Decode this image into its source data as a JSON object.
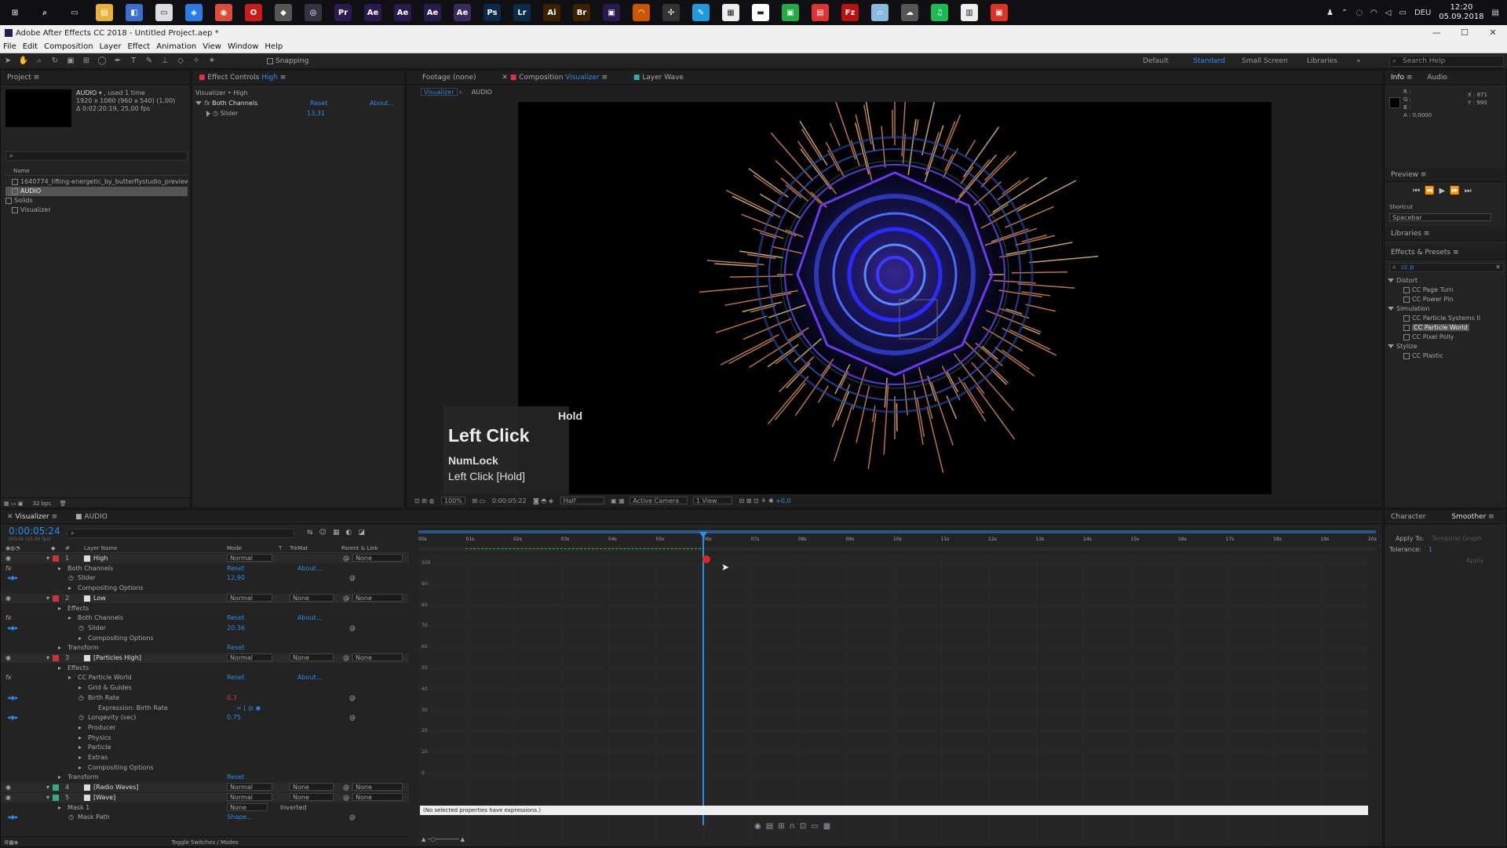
{
  "taskbar": {
    "apps": [
      {
        "name": "windows-start",
        "label": "⊞",
        "color": "#0f0f14"
      },
      {
        "name": "search",
        "label": "⌕",
        "color": "#0f0f14"
      },
      {
        "name": "task-view",
        "label": "▭",
        "color": "#0f0f14"
      },
      {
        "name": "file-explorer",
        "label": "▤",
        "color": "#e8b13a"
      },
      {
        "name": "app-blue",
        "label": "◧",
        "color": "#3a6fd0"
      },
      {
        "name": "app-white",
        "label": "▭",
        "color": "#dddddd"
      },
      {
        "name": "store",
        "label": "◈",
        "color": "#2a7be4"
      },
      {
        "name": "chrome",
        "label": "◉",
        "color": "#dd4b39"
      },
      {
        "name": "opera",
        "label": "O",
        "color": "#cc1b1b"
      },
      {
        "name": "app-gray",
        "label": "◆",
        "color": "#555555"
      },
      {
        "name": "app-obs",
        "label": "◎",
        "color": "#333344"
      },
      {
        "name": "premiere",
        "label": "Pr",
        "color": "#2a1a4d"
      },
      {
        "name": "after-effects-a",
        "label": "Ae",
        "color": "#2a1a4d"
      },
      {
        "name": "after-effects-b",
        "label": "Ae",
        "color": "#2a1a4d"
      },
      {
        "name": "after-effects-c",
        "label": "Ae",
        "color": "#2a1a4d"
      },
      {
        "name": "after-effects-d",
        "label": "Ae",
        "color": "#3a2a5d"
      },
      {
        "name": "photoshop",
        "label": "Ps",
        "color": "#0a2a4a"
      },
      {
        "name": "lightroom",
        "label": "Lr",
        "color": "#0a2a4a"
      },
      {
        "name": "illustrator",
        "label": "Ai",
        "color": "#3a2200"
      },
      {
        "name": "bridge",
        "label": "Br",
        "color": "#3a2200"
      },
      {
        "name": "media-encoder",
        "label": "▣",
        "color": "#2a1a4d"
      },
      {
        "name": "audition",
        "label": "◠",
        "color": "#cc5500"
      },
      {
        "name": "app-tools",
        "label": "✣",
        "color": "#333333"
      },
      {
        "name": "app-brush",
        "label": "✎",
        "color": "#2299dd"
      },
      {
        "name": "app-note",
        "label": "▦",
        "color": "#eeeeee"
      },
      {
        "name": "app-capture",
        "label": "▬",
        "color": "#ffffff"
      },
      {
        "name": "app-green",
        "label": "▣",
        "color": "#22aa44"
      },
      {
        "name": "app-redbox",
        "label": "▤",
        "color": "#dd3333"
      },
      {
        "name": "filezilla",
        "label": "Fz",
        "color": "#bb1111"
      },
      {
        "name": "app-notepad",
        "label": "▱",
        "color": "#88bbdd"
      },
      {
        "name": "app-cloud",
        "label": "☁",
        "color": "#555555"
      },
      {
        "name": "spotify",
        "label": "♫",
        "color": "#1db954"
      },
      {
        "name": "app-clapper",
        "label": "▥",
        "color": "#eeeeee"
      },
      {
        "name": "app-red-square",
        "label": "▣",
        "color": "#dd3322"
      }
    ],
    "tray_lang": "DEU",
    "time": "12:20",
    "date": "05.09.2018"
  },
  "window": {
    "title": "Adobe After Effects CC 2018 - Untitled Project.aep *"
  },
  "menu": [
    "File",
    "Edit",
    "Composition",
    "Layer",
    "Effect",
    "Animation",
    "View",
    "Window",
    "Help"
  ],
  "toolbar": {
    "snapping": "Snapping",
    "workspaces": [
      "Default",
      "Standard",
      "Small Screen",
      "Libraries"
    ],
    "search_placeholder": "Search Help"
  },
  "project": {
    "tab": "Project",
    "item_name": "AUDIO",
    "item_used": ", used 1 time",
    "item_info1": "1920 x 1080 (960 x 540) (1,00)",
    "item_info2": "Δ 0:02:20:19, 25,00 fps",
    "col_name": "Name",
    "items": [
      {
        "label": "1640774_lifting-energetic_by_butterflystudio_preview",
        "sel": false
      },
      {
        "label": "AUDIO",
        "sel": true
      },
      {
        "label": "Solids",
        "sel": false
      },
      {
        "label": "Visualizer",
        "sel": false
      }
    ],
    "bpc": "32 bpc"
  },
  "effect_controls": {
    "tab": "Effect Controls",
    "tab_layer": "High",
    "path": "Visualizer • High",
    "effect": "Both Channels",
    "reset": "Reset",
    "about": "About...",
    "slider_label": "Slider",
    "slider_value": "13,31"
  },
  "viewer": {
    "tabs": [
      "Footage (none)",
      "Composition",
      "Layer Wave"
    ],
    "comp_name": "Visualizer",
    "subtabs": [
      "Visualizer",
      "AUDIO"
    ],
    "overlay": {
      "hold": "Hold",
      "main": "Left Click",
      "sub1": "NumLock",
      "sub2": "Left Click [Hold]"
    },
    "zoom": "100%",
    "timecode": "0:00:05:22",
    "resolution": "Half",
    "camera": "Active Camera",
    "views": "1 View",
    "exposure": "+0,0"
  },
  "info": {
    "tab": "Info",
    "tab2": "Audio",
    "r": "R :",
    "g": "G :",
    "b": "B :",
    "a": "A : 0,0000",
    "x": "X : 871",
    "y": "Y : 990"
  },
  "preview": {
    "tab": "Preview",
    "shortcut_label": "Shortcut",
    "shortcut_value": "Spacebar"
  },
  "libraries": {
    "tab": "Libraries"
  },
  "effects_presets": {
    "tab": "Effects & Presets",
    "search": "cc p",
    "groups": [
      {
        "name": "Distort",
        "items": [
          "CC Page Turn",
          "CC Power Pin"
        ]
      },
      {
        "name": "Simulation",
        "items": [
          "CC Particle Systems II",
          "CC Particle World",
          "CC Pixel Polly"
        ]
      },
      {
        "name": "Stylize",
        "items": [
          "CC Plastic"
        ]
      }
    ],
    "selected": "CC Particle World"
  },
  "character": {
    "tab": "Character",
    "tab2": "Smoother",
    "apply_to": "Apply To:",
    "apply_value": "Temporal Graph",
    "tolerance": "Tolerance:",
    "tolerance_value": "1",
    "apply_btn": "Apply"
  },
  "timeline": {
    "tabs": [
      "Visualizer",
      "AUDIO"
    ],
    "timecode": "0:00:05:24",
    "timecode_sub": "00149 (25.00 fps)",
    "cols": {
      "layer_name": "Layer Name",
      "mode": "Mode",
      "t": "T",
      "trkmat": "TrkMat",
      "parent": "Parent & Link"
    },
    "rows": [
      {
        "type": "layer",
        "num": "1",
        "name": "High",
        "color": "#c33",
        "mode": "Normal",
        "trk": "",
        "parent": "None",
        "indent": 0
      },
      {
        "type": "effect",
        "name": "Both Channels",
        "reset": "Reset",
        "about": "About...",
        "indent": 1
      },
      {
        "type": "prop",
        "name": "Slider",
        "value": "12,90",
        "indent": 2
      },
      {
        "type": "group",
        "name": "Compositing Options",
        "indent": 2
      },
      {
        "type": "layer",
        "num": "2",
        "name": "Low",
        "color": "#c33",
        "mode": "Normal",
        "trk": "None",
        "parent": "None",
        "indent": 0
      },
      {
        "type": "group",
        "name": "Effects",
        "indent": 1
      },
      {
        "type": "effect",
        "name": "Both Channels",
        "reset": "Reset",
        "about": "About...",
        "indent": 2
      },
      {
        "type": "prop",
        "name": "Slider",
        "value": "20,36",
        "indent": 3
      },
      {
        "type": "group",
        "name": "Compositing Options",
        "indent": 3
      },
      {
        "type": "group",
        "name": "Transform",
        "reset": "Reset",
        "indent": 1
      },
      {
        "type": "layer",
        "num": "3",
        "name": "[Particles High]",
        "color": "#c33",
        "mode": "Normal",
        "trk": "None",
        "parent": "None",
        "indent": 0
      },
      {
        "type": "group",
        "name": "Effects",
        "indent": 1
      },
      {
        "type": "effect",
        "name": "CC Particle World",
        "reset": "Reset",
        "about": "About...",
        "indent": 2
      },
      {
        "type": "group",
        "name": "Grid & Guides",
        "indent": 3
      },
      {
        "type": "prop",
        "name": "Birth Rate",
        "value": "0,3",
        "red": true,
        "indent": 3
      },
      {
        "type": "expr",
        "name": "Expression: Birth Rate",
        "indent": 4
      },
      {
        "type": "prop",
        "name": "Longevity (sec)",
        "value": "0,75",
        "indent": 3
      },
      {
        "type": "group",
        "name": "Producer",
        "indent": 3
      },
      {
        "type": "group",
        "name": "Physics",
        "indent": 3
      },
      {
        "type": "group",
        "name": "Particle",
        "indent": 3
      },
      {
        "type": "group",
        "name": "Extras",
        "indent": 3
      },
      {
        "type": "group",
        "name": "Compositing Options",
        "indent": 3
      },
      {
        "type": "group",
        "name": "Transform",
        "reset": "Reset",
        "indent": 1
      },
      {
        "type": "layer",
        "num": "4",
        "name": "[Radio Waves]",
        "color": "#3a8",
        "mode": "Normal",
        "trk": "None",
        "parent": "None",
        "indent": 0
      },
      {
        "type": "layer",
        "num": "5",
        "name": "[Wave]",
        "color": "#3a8",
        "mode": "Normal",
        "trk": "None",
        "parent": "None",
        "indent": 0
      },
      {
        "type": "group",
        "name": "Mask 1",
        "mode": "None",
        "inv": "Inverted",
        "indent": 1
      },
      {
        "type": "prop",
        "name": "Mask Path",
        "value": "Shape...",
        "indent": 2
      }
    ],
    "ruler": [
      "00s",
      "01s",
      "02s",
      "03s",
      "04s",
      "05s",
      "06s",
      "07s",
      "08s",
      "09s",
      "10s",
      "11s",
      "12s",
      "13s",
      "14s",
      "15s",
      "16s",
      "17s",
      "18s",
      "19s",
      "20s"
    ],
    "graph_y": [
      "100",
      "90",
      "80",
      "70",
      "60",
      "50",
      "40",
      "30",
      "20",
      "10",
      "0"
    ],
    "expr_msg": "(No selected properties have expressions.)",
    "toggle": "Toggle Switches / Modes"
  }
}
